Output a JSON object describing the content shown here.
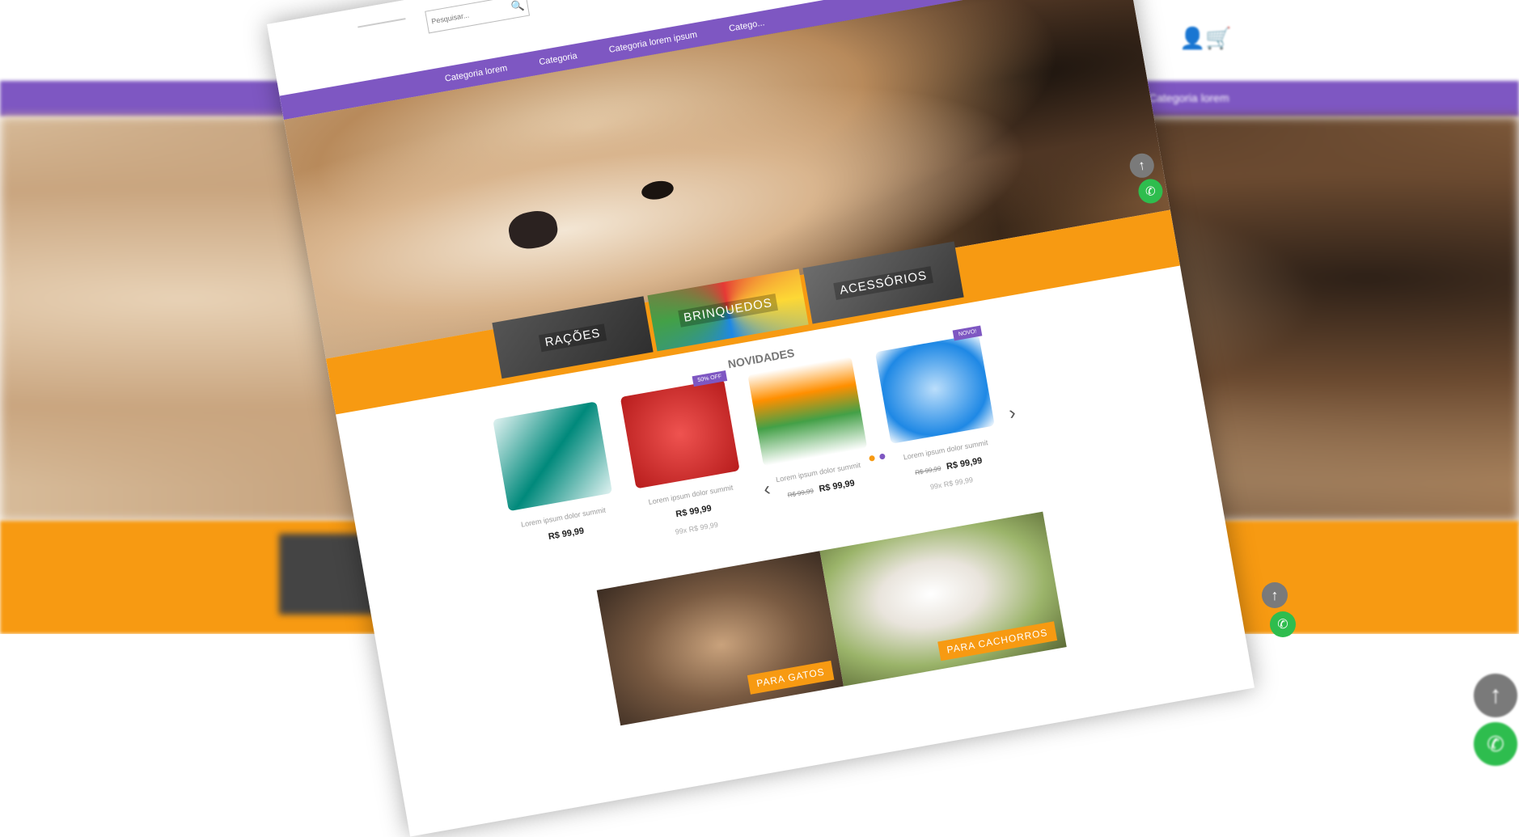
{
  "header": {
    "search_placeholder": "Pesquisar..."
  },
  "nav": {
    "items": [
      "Categoria lorem",
      "Categoria",
      "Categoria lorem ipsum",
      "Catego..."
    ]
  },
  "categories": {
    "racoes": "RAÇÕES",
    "brinquedos": "BRINQUEDOS",
    "acessorios": "ACESSÓRIOS"
  },
  "novidades": {
    "title": "NOVIDADES",
    "products": [
      {
        "name": "Lorem ipsum dolor summit",
        "old_price": "",
        "price": "R$ 99,99",
        "installments": "",
        "badge": ""
      },
      {
        "name": "Lorem ipsum dolor summit",
        "old_price": "",
        "price": "R$ 99,99",
        "installments": "99x R$ 99,99",
        "badge": "50% OFF"
      },
      {
        "name": "Lorem ipsum dolor summit",
        "old_price": "R$ 99,99",
        "price": "R$ 99,99",
        "installments": "",
        "badge": ""
      },
      {
        "name": "Lorem ipsum dolor summit",
        "old_price": "R$ 99,99",
        "price": "R$ 99,99",
        "installments": "99x R$ 99,99",
        "badge": "NOVO!"
      }
    ]
  },
  "banners": {
    "gatos": "PARA GATOS",
    "cachorros": "PARA CACHORROS"
  },
  "background": {
    "nav_label": "Categoria lorem"
  },
  "icons": {
    "up": "arrow-up-icon",
    "whatsapp": "whatsapp-icon",
    "user": "user-icon",
    "cart": "cart-icon",
    "search": "search-icon"
  },
  "colors": {
    "purple": "#7e57c2",
    "orange": "#f79a12",
    "whatsapp_green": "#2ebd4e",
    "grey_button": "#7a7a7a"
  }
}
